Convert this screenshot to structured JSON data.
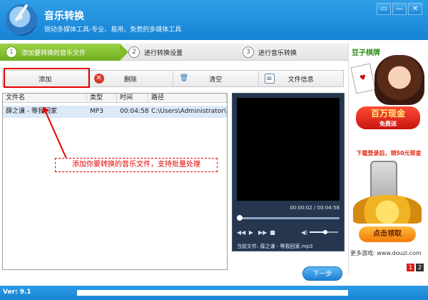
{
  "app": {
    "title": "音乐转换",
    "subtitle": "锐动多媒体工具-专业、易用、免费的多媒体工具",
    "window_buttons": [
      "▭",
      "—",
      "✕"
    ]
  },
  "steps": [
    {
      "num": "1",
      "label": "添加要转换的音乐文件"
    },
    {
      "num": "2",
      "label": "进行转换设置"
    },
    {
      "num": "3",
      "label": "进行音乐转换"
    }
  ],
  "toolbar": {
    "add_label": "添加",
    "delete_label": "删除",
    "clear_label": "清空",
    "info_label": "文件信息",
    "icons": {
      "delete": "delete-x-icon",
      "clear": "trash-icon",
      "info": "document-info-icon"
    }
  },
  "file_list": {
    "columns": [
      "文件名",
      "类型",
      "时间",
      "路径"
    ],
    "rows": [
      {
        "name": "薛之谦 - 等我回家",
        "type": "MP3",
        "time": "00:04:58",
        "path": "C:\\Users\\Administrator\\D..."
      }
    ]
  },
  "tip": "添加你要转换的音乐文件，支持批量处理",
  "player": {
    "time_display": "00:00:02 / 00:04:58",
    "progress_fraction": 0.01,
    "volume_fraction": 0.55,
    "now_playing": "当前文件: 薛之谦 - 等我回家.mp3",
    "controls": [
      "◀◀",
      "▶",
      "▶▶",
      "■"
    ],
    "volume_icon": "◀)"
  },
  "next_button": "下一步",
  "ad": {
    "brand": "豆子棋牌",
    "cash_big": "百万现金",
    "cash_small": "免费送",
    "promo_line": "下载登录后，领50元现金",
    "claim_button": "点击领取",
    "more_link": "更多游戏: www.douzi.com",
    "pages": [
      "1",
      "2"
    ],
    "card_glyph": "♥"
  },
  "status": {
    "version": "Ver: 9.1"
  }
}
